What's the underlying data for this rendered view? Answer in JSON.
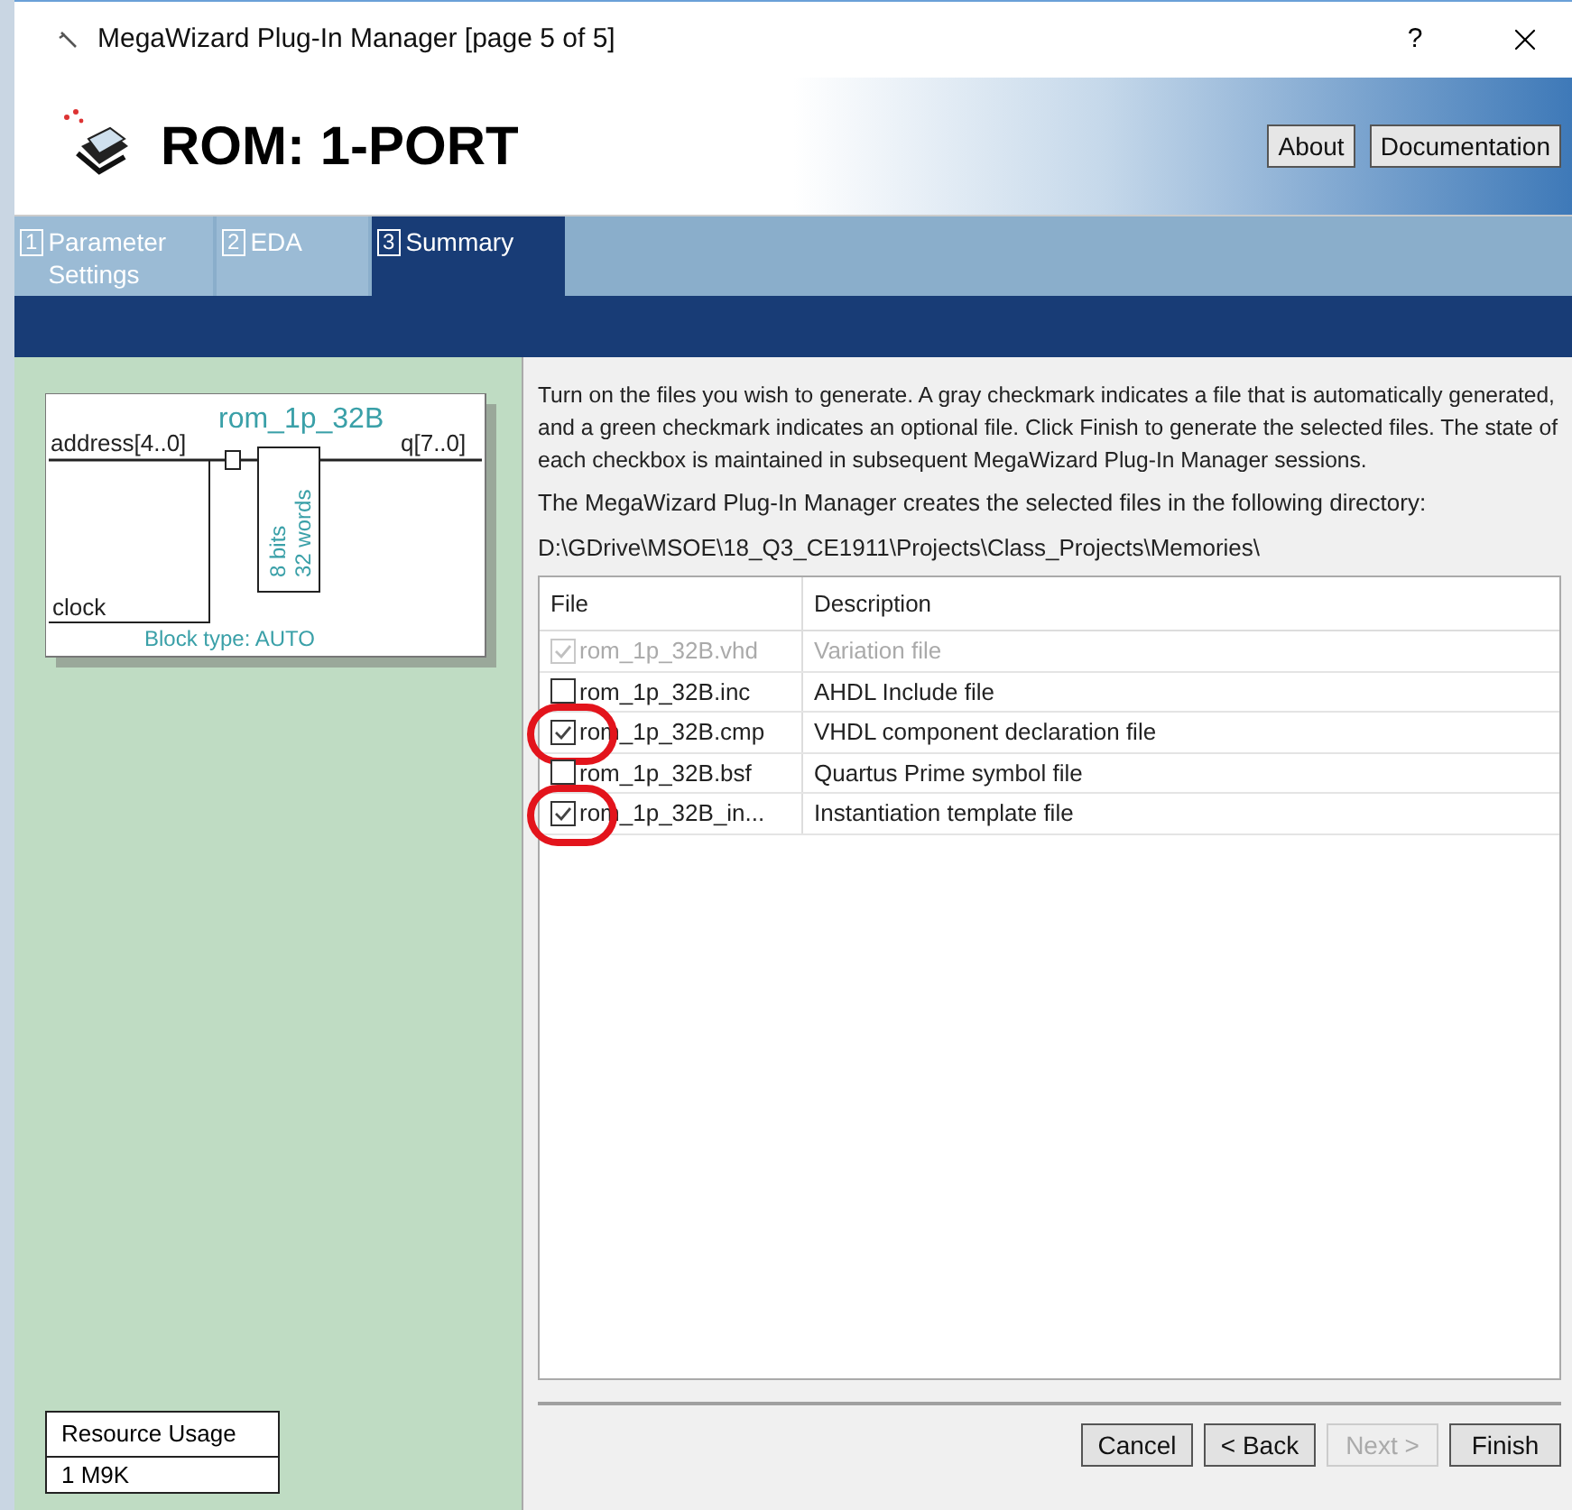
{
  "window": {
    "title": "MegaWizard Plug-In Manager [page 5 of 5]",
    "help": "?"
  },
  "header": {
    "title": "ROM: 1-PORT",
    "buttons": [
      "About",
      "Documentation"
    ]
  },
  "tabs": [
    {
      "number": "1",
      "label": "Parameter Settings",
      "selected": false
    },
    {
      "number": "2",
      "label": "EDA",
      "selected": false
    },
    {
      "number": "3",
      "label": "Summary",
      "selected": true
    }
  ],
  "symbol": {
    "name": "rom_1p_32B",
    "input_port": "address[4..0]",
    "output_port": "q[7..0]",
    "clock_port": "clock",
    "width_label": "8 bits",
    "depth_label": "32 words",
    "block_type": "Block type: AUTO"
  },
  "resource_usage": {
    "title": "Resource Usage",
    "value": "1 M9K"
  },
  "instructions": "Turn on the files you wish to generate. A gray checkmark indicates a file that is automatically generated, and a green checkmark indicates an optional file. Click Finish to generate the selected files. The state of each checkbox is maintained in subsequent MegaWizard Plug-In Manager sessions.",
  "directory_note": "The MegaWizard Plug-In Manager creates the selected files in the following directory:",
  "directory": "D:\\GDrive\\MSOE\\18_Q3_CE1911\\Projects\\Class_Projects\\Memories\\",
  "table": {
    "columns": [
      "File",
      "Description"
    ],
    "rows": [
      {
        "file": "rom_1p_32B.vhd",
        "description": "Variation file",
        "checked": true,
        "disabled": true,
        "circled": false
      },
      {
        "file": "rom_1p_32B.inc",
        "description": "AHDL Include file",
        "checked": false,
        "disabled": false,
        "circled": false
      },
      {
        "file": "rom_1p_32B.cmp",
        "description": "VHDL component declaration file",
        "checked": true,
        "disabled": false,
        "circled": true
      },
      {
        "file": "rom_1p_32B.bsf",
        "description": "Quartus Prime symbol file",
        "checked": false,
        "disabled": false,
        "circled": false
      },
      {
        "file": "rom_1p_32B_in...",
        "description": "Instantiation template file",
        "checked": true,
        "disabled": false,
        "circled": true
      }
    ]
  },
  "buttons": [
    {
      "label": "Cancel",
      "disabled": false
    },
    {
      "label": "< Back",
      "disabled": false
    },
    {
      "label": "Next >",
      "disabled": true
    },
    {
      "label": "Finish",
      "disabled": false
    }
  ]
}
